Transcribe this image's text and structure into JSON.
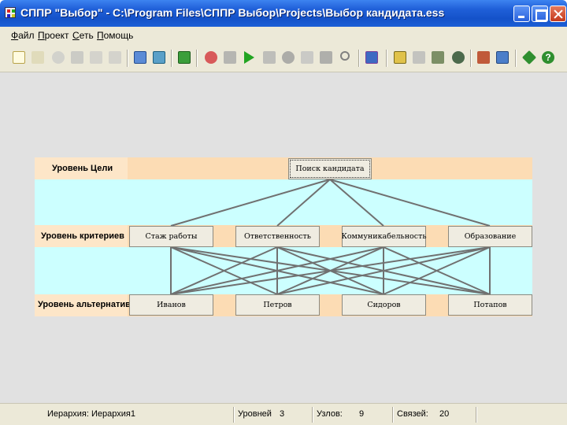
{
  "window": {
    "title": "СППР \"Выбор\" - C:\\Program Files\\СППР Выбор\\Projects\\Выбор кандидата.ess"
  },
  "menu": [
    "Файл",
    "Проект",
    "Сеть",
    "Помощь"
  ],
  "toolbar_icons": [
    "new-file-icon",
    "open-folder-icon",
    "reload-icon",
    "save-icon",
    "cut-icon",
    "copy-icon",
    "notepad-icon",
    "chart-icon",
    "exit-icon",
    "network-icon",
    "gears-icon",
    "run-icon",
    "tools-icon",
    "sphere-icon",
    "preview-icon",
    "graph-icon",
    "search-icon",
    "export-icon",
    "list-icon",
    "people-icon",
    "users-icon",
    "user-head-icon",
    "presenter-icon",
    "database-icon",
    "cube-icon",
    "check-icon",
    "help-icon"
  ],
  "levels": {
    "goal": "Уровень Цели",
    "criteria": "Уровень критериев",
    "alternatives": "Уровень альтернатив"
  },
  "nodes": {
    "goal": "Поиск кандидата",
    "criteria": [
      "Стаж работы",
      "Ответственность",
      "Коммуникабельность",
      "Образование"
    ],
    "alternatives": [
      "Иванов",
      "Петров",
      "Сидоров",
      "Потапов"
    ]
  },
  "status": {
    "hierarchy_label": "Иерархия:",
    "hierarchy_value": "Иерархия1",
    "levels_label": "Уровней",
    "levels_value": "3",
    "nodes_label": "Узлов:",
    "nodes_value": "9",
    "links_label": "Связей:",
    "links_value": "20"
  },
  "colors": {
    "level_band": "#fcdcb4",
    "gap_band": "#ccffff",
    "link_line": "#707070"
  }
}
